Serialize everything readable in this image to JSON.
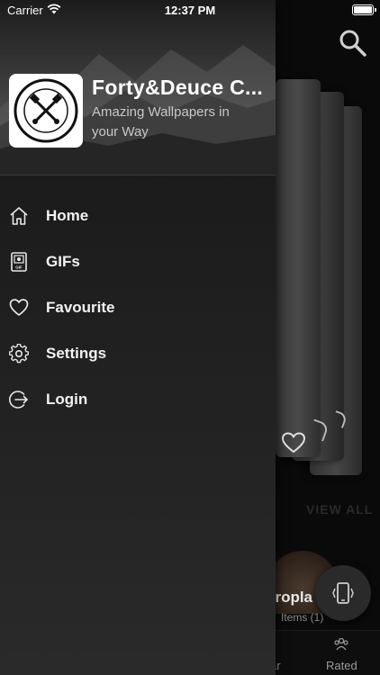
{
  "status_bar": {
    "carrier": "Carrier",
    "time": "12:37 PM"
  },
  "drawer": {
    "app_name": "Forty&Deuce C...",
    "tagline": "Amazing Wallpapers in your Way",
    "logo": {
      "top_text": "FORTY AND DEUCE",
      "bottom_text": "LEGEND"
    },
    "menu": [
      {
        "label": "Home",
        "icon": "home-icon"
      },
      {
        "label": "GIFs",
        "icon": "gif-icon"
      },
      {
        "label": "Favourite",
        "icon": "heart-icon"
      },
      {
        "label": "Settings",
        "icon": "gear-icon"
      },
      {
        "label": "Login",
        "icon": "login-icon"
      }
    ]
  },
  "background": {
    "view_all": "VIEW ALL",
    "item_title": "eropla",
    "item_subtitle": "Items (1)",
    "tabs": [
      {
        "label": "ar"
      },
      {
        "label": "Rated"
      }
    ]
  },
  "colors": {
    "drawer_top": "#161616",
    "drawer_bottom": "#2a2a2a",
    "text": "#f2f2f2",
    "tagline": "#c8c8c8"
  }
}
